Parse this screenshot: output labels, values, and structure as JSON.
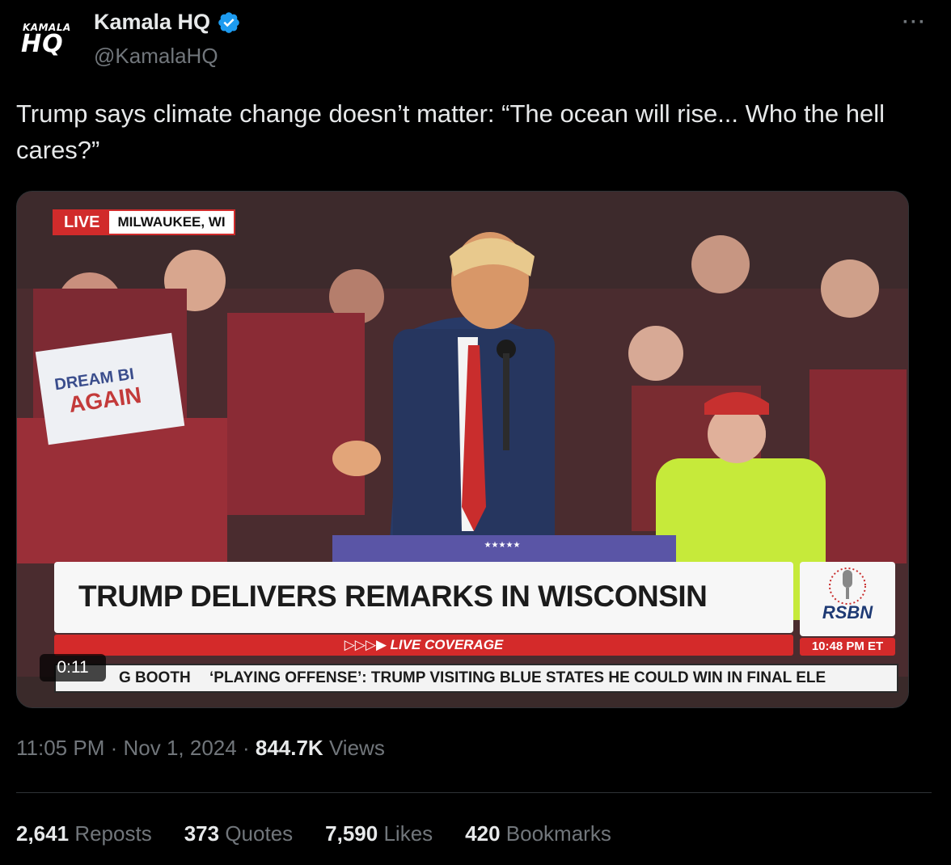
{
  "author": {
    "avatar_small": "KAMALA",
    "avatar_big": "HQ",
    "name": "Kamala HQ",
    "handle": "@KamalaHQ",
    "verified_icon": "verified-badge-icon"
  },
  "more_label": "···",
  "tweet_text": "Trump says climate change doesn’t matter: “The ocean will rise... Who the hell cares?”",
  "video": {
    "live_label": "LIVE",
    "location": "MILWAUKEE, WI",
    "headline": "TRUMP DELIVERS REMARKS IN WISCONSIN",
    "coverage": "LIVE COVERAGE",
    "coverage_arrows": "▷▷▷▶",
    "network": "RSBN",
    "time": "10:48 PM ET",
    "ticker_left": "G BOOTH",
    "ticker_right": "‘PLAYING OFFENSE’: TRUMP VISITING BLUE STATES HE COULD WIN IN FINAL ELE",
    "duration": "0:11",
    "sign_text_1": "DREAM BI",
    "sign_text_2": "AGAIN"
  },
  "meta": {
    "time": "11:05 PM",
    "date": "Nov 1, 2024",
    "views_count": "844.7K",
    "views_label": "Views",
    "separator": "·"
  },
  "stats": {
    "reposts_count": "2,641",
    "reposts_label": "Reposts",
    "quotes_count": "373",
    "quotes_label": "Quotes",
    "likes_count": "7,590",
    "likes_label": "Likes",
    "bookmarks_count": "420",
    "bookmarks_label": "Bookmarks"
  },
  "colors": {
    "accent": "#1d9bf0",
    "muted": "#71767b",
    "ticker_red": "#d42a2a"
  }
}
